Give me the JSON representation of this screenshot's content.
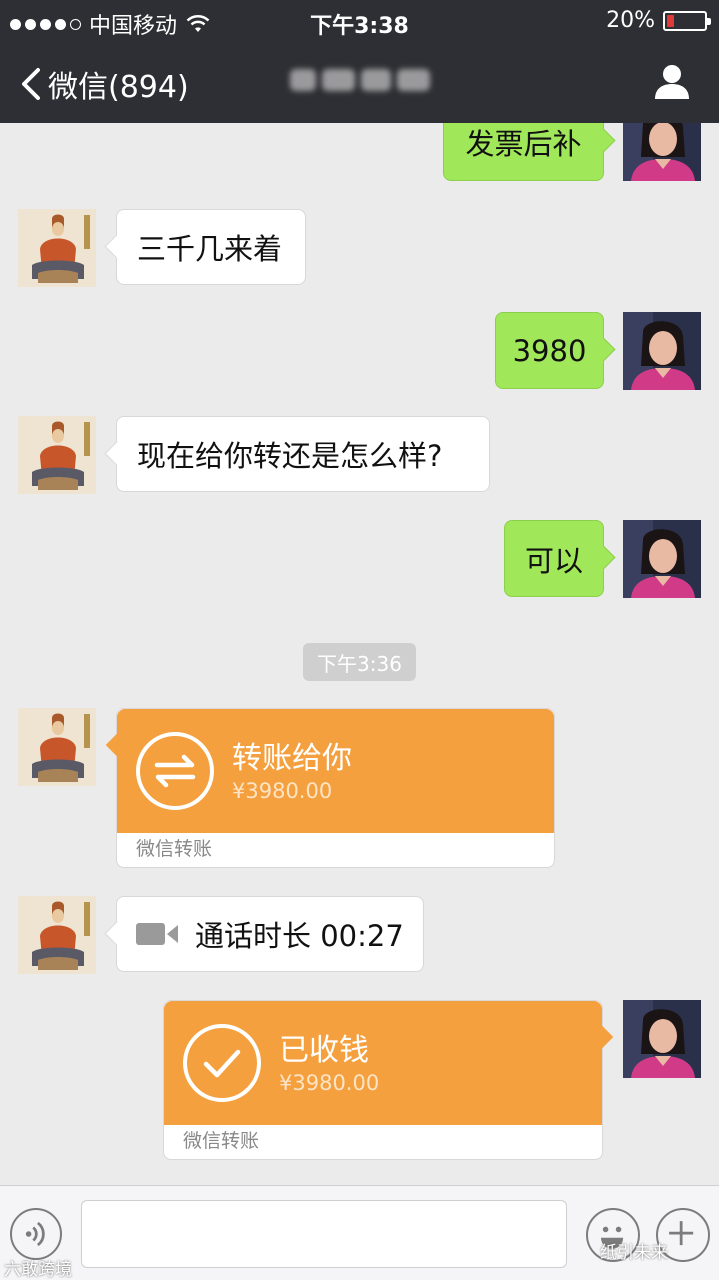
{
  "status_bar": {
    "carrier": "中国移动",
    "time": "下午3:38",
    "battery_percent": "20%",
    "battery_level": 0.2,
    "signal_bars_filled": 4,
    "colors": {
      "battery_low": "#e03a3a"
    }
  },
  "nav": {
    "back_label": "微信(894)",
    "icons": {
      "back": "chevron-left-icon",
      "profile": "person-icon"
    }
  },
  "messages": [
    {
      "side": "right",
      "text": "发票后补"
    },
    {
      "side": "left",
      "text": "三千几来着"
    },
    {
      "side": "right",
      "text": "3980"
    },
    {
      "side": "left",
      "text": "现在给你转还是怎么样?"
    },
    {
      "side": "right",
      "text": "可以"
    }
  ],
  "timestamp": "下午3:36",
  "transfer_sent": {
    "title": "转账给你",
    "amount": "¥3980.00",
    "footer": "微信转账"
  },
  "call_record": {
    "text": "通话时长 00:27",
    "icon": "video-call-icon"
  },
  "transfer_received": {
    "title": "已收钱",
    "amount": "¥3980.00",
    "footer": "微信转账"
  },
  "input_bar": {
    "icons": {
      "voice": "voice-icon",
      "emoji": "emoji-icon",
      "more": "plus-icon"
    }
  },
  "watermarks": {
    "left": "六敢跨境",
    "right": "纸引未来"
  },
  "colors": {
    "nav_bg": "#2e2f34",
    "chat_bg": "#ebebeb",
    "bubble_green": "#a0e75a",
    "transfer_orange": "#f5a03f"
  }
}
